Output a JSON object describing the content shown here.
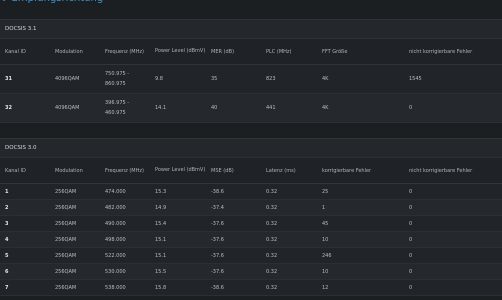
{
  "page": {
    "title": "↓ Empfangsrichtung"
  },
  "docsis31": {
    "heading": "DOCSIS 3.1",
    "columns": [
      "Kanal ID",
      "Modulation",
      "Frequenz (MHz)",
      "Power Level (dBmV)",
      "MER (dB)",
      "PLC (MHz)",
      "FFT Größe",
      "nicht korrigierbare Fehler"
    ],
    "rows": [
      {
        "kanal": "31",
        "modulation": "4096QAM",
        "freq": "750.975 - 860.975",
        "power": "9.8",
        "mer": "35",
        "plc": "823",
        "fft": "4K",
        "fehler": "1545"
      },
      {
        "kanal": "32",
        "modulation": "4096QAM",
        "freq": "396.975 - 460.975",
        "power": "14.1",
        "mer": "40",
        "plc": "441",
        "fft": "4K",
        "fehler": "0"
      }
    ]
  },
  "docsis30": {
    "heading": "DOCSIS 3.0",
    "columns": [
      "Kanal ID",
      "Modulation",
      "Frequenz (MHz)",
      "Power Level (dBmV)",
      "MSE (dB)",
      "Latenz (ms)",
      "korrigierbare Fehler",
      "nicht korrigierbare Fehler"
    ],
    "rows": [
      {
        "kanal": "1",
        "modulation": "256QAM",
        "freq": "474.000",
        "power": "15.3",
        "mse": "-38.6",
        "latenz": "0.32",
        "korr": "25",
        "fehler": "0"
      },
      {
        "kanal": "2",
        "modulation": "256QAM",
        "freq": "482.000",
        "power": "14.9",
        "mse": "-37.4",
        "latenz": "0.32",
        "korr": "1",
        "fehler": "0"
      },
      {
        "kanal": "3",
        "modulation": "256QAM",
        "freq": "490.000",
        "power": "15.4",
        "mse": "-37.6",
        "latenz": "0.32",
        "korr": "45",
        "fehler": "0"
      },
      {
        "kanal": "4",
        "modulation": "256QAM",
        "freq": "498.000",
        "power": "15.1",
        "mse": "-37.6",
        "latenz": "0.32",
        "korr": "10",
        "fehler": "0"
      },
      {
        "kanal": "5",
        "modulation": "256QAM",
        "freq": "522.000",
        "power": "15.1",
        "mse": "-37.6",
        "latenz": "0.32",
        "korr": "246",
        "fehler": "0"
      },
      {
        "kanal": "6",
        "modulation": "256QAM",
        "freq": "530.000",
        "power": "15.5",
        "mse": "-37.6",
        "latenz": "0.32",
        "korr": "10",
        "fehler": "0"
      },
      {
        "kanal": "7",
        "modulation": "256QAM",
        "freq": "538.000",
        "power": "15.8",
        "mse": "-38.6",
        "latenz": "0.32",
        "korr": "12",
        "fehler": "0"
      }
    ]
  }
}
